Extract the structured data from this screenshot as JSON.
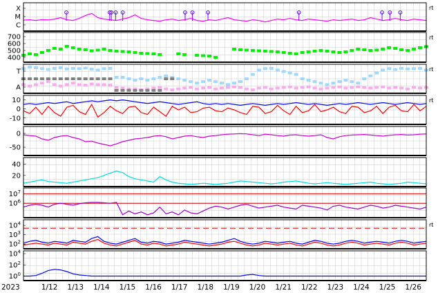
{
  "chart_data": [
    {
      "type": "line",
      "panel": "xray-class",
      "yticks": [
        "X",
        "M",
        "C"
      ],
      "series": [
        {
          "color": "#ff00ff",
          "values": [
            1.55,
            1.6,
            1.5,
            1.62,
            1.58,
            1.7,
            1.9,
            1.6,
            1.5,
            1.8,
            2.2,
            2.5,
            1.9,
            1.7,
            1.6,
            1.5,
            1.7,
            1.9,
            2.3,
            1.8,
            1.6,
            1.5,
            1.4,
            1.6,
            1.7,
            1.5,
            1.6,
            1.8,
            1.5,
            1.4,
            1.6,
            1.5,
            1.7,
            1.9,
            1.6,
            1.5,
            1.4,
            1.6,
            1.5,
            1.3,
            1.5,
            1.7,
            1.6,
            1.8,
            1.6,
            1.5,
            1.7,
            1.6,
            1.5,
            1.4,
            1.6,
            1.5,
            1.6,
            1.7,
            1.5,
            1.6,
            1.9,
            1.7,
            1.5,
            1.6,
            1.8,
            1.6,
            1.5,
            1.7,
            1.6,
            1.5
          ]
        }
      ],
      "event_days": [
        12.65,
        14.32,
        14.38,
        14.55,
        14.82,
        17.22,
        17.5,
        18.1,
        21.6,
        24.8,
        25.1,
        25.5
      ],
      "ylim": [
        0,
        4
      ]
    },
    {
      "type": "scatter",
      "panel": "solar-wind-speed",
      "yticks": [
        400,
        500,
        600,
        700
      ],
      "ylim": [
        330,
        760
      ],
      "series": [
        {
          "color": "#00ee00",
          "values": [
            430,
            450,
            440,
            470,
            500,
            530,
            520,
            560,
            540,
            520,
            510,
            495,
            505,
            520,
            500,
            490,
            485,
            480,
            470,
            460,
            455,
            450,
            440,
            null,
            null,
            450,
            440,
            null,
            430,
            425,
            420,
            400,
            null,
            null,
            520,
            510,
            505,
            500,
            495,
            490,
            485,
            480,
            470,
            460,
            450,
            470,
            480,
            490,
            500,
            490,
            480,
            470,
            480,
            500,
            520,
            510,
            500,
            505,
            520,
            540,
            530,
            510,
            500,
            520,
            540,
            555
          ]
        }
      ]
    },
    {
      "type": "scatter",
      "panel": "imf-sector",
      "yticks": [
        "T",
        "A"
      ],
      "series": [
        {
          "color": "#a0d8ff",
          "values": [
            0.85,
            0.9,
            0.88,
            0.85,
            0.82,
            0.86,
            0.88,
            0.84,
            0.86,
            0.85,
            0.87,
            0.83,
            0.8,
            0.85,
            0.86,
            0.55,
            0.55,
            0.5,
            0.45,
            0.5,
            0.45,
            0.5,
            0.55,
            0.6,
            0.55,
            0.5,
            0.45,
            0.4,
            0.35,
            0.4,
            0.45,
            0.4,
            0.35,
            0.3,
            0.35,
            0.4,
            0.5,
            0.65,
            0.8,
            0.85,
            0.86,
            0.8,
            0.75,
            0.7,
            0.65,
            0.5,
            0.45,
            0.4,
            0.35,
            0.3,
            0.35,
            0.4,
            0.45,
            0.4,
            0.35,
            0.5,
            0.6,
            0.7,
            0.8,
            0.85,
            0.82,
            0.86,
            0.84,
            0.85,
            0.86,
            0.8
          ]
        },
        {
          "color": "#ffaaee",
          "values": [
            0.3,
            0.25,
            0.3,
            0.35,
            0.4,
            0.3,
            0.25,
            0.3,
            0.35,
            0.3,
            0.28,
            0.32,
            0.3,
            0.3,
            0.28,
            0.2,
            0.18,
            0.15,
            0.15,
            0.12,
            0.15,
            0.18,
            0.2,
            0.15,
            0.12,
            0.15,
            0.18,
            0.2,
            0.15,
            0.18,
            0.2,
            0.15,
            0.18,
            0.2,
            0.22,
            0.2,
            0.15,
            0.12,
            0.18,
            0.2,
            0.15,
            0.18,
            0.2,
            0.22,
            0.18,
            0.2,
            0.22,
            0.18,
            0.15,
            0.18,
            0.2,
            0.22,
            0.18,
            0.2,
            0.22,
            0.2,
            0.18,
            0.2,
            0.22,
            0.18,
            0.2,
            0.18,
            0.15,
            0.2,
            0.18,
            0.2
          ]
        },
        {
          "color": "#808080",
          "values": [
            0.5,
            0.5,
            0.5,
            0.5,
            0.5,
            0.5,
            0.5,
            0.5,
            0.5,
            0.5,
            0.5,
            0.5,
            0.5,
            0.5,
            0.5,
            0.1,
            0.1,
            0.1,
            0.1,
            0.1,
            0.1,
            0.1,
            0.1,
            0.5,
            0.5,
            null,
            null,
            null,
            null,
            null,
            null,
            null,
            null,
            null,
            null,
            null,
            null,
            null,
            null,
            null,
            null,
            null,
            null,
            null,
            null,
            null,
            null,
            null,
            null,
            null,
            null,
            null,
            null,
            null,
            null,
            null,
            null,
            null,
            null,
            null,
            null,
            null,
            null,
            null,
            null,
            null
          ]
        }
      ]
    },
    {
      "type": "line",
      "panel": "imf-bz-bt",
      "yticks": [
        10,
        0,
        -10
      ],
      "ylim": [
        -17,
        15
      ],
      "series": [
        {
          "color": "#0000ee",
          "values": [
            5,
            6,
            5,
            6,
            7,
            6,
            7,
            8,
            6,
            7,
            8,
            9,
            8,
            9,
            10,
            9,
            10,
            9,
            8,
            7,
            6,
            7,
            8,
            7,
            6,
            5,
            6,
            7,
            8,
            6,
            5,
            6,
            5,
            6,
            5,
            4,
            5,
            6,
            5,
            4,
            5,
            6,
            5,
            6,
            7,
            6,
            5,
            6,
            5,
            4,
            5,
            6,
            5,
            6,
            7,
            6,
            5,
            6,
            7,
            6,
            5,
            6,
            7,
            6,
            5,
            6
          ]
        },
        {
          "color": "#ff0000",
          "values": [
            -2,
            -5,
            2,
            -6,
            3,
            -4,
            -8,
            2,
            4,
            -3,
            -6,
            5,
            -9,
            -4,
            3,
            -2,
            -5,
            2,
            3,
            -4,
            -6,
            2,
            -3,
            -8,
            3,
            -1,
            2,
            -4,
            -3,
            1,
            2,
            -2,
            -3,
            1,
            -1,
            -4,
            -6,
            3,
            2,
            -5,
            -3,
            4,
            -2,
            -6,
            3,
            -4,
            -2,
            5,
            -3,
            -1,
            2,
            -3,
            -5,
            3,
            2,
            -4,
            -2,
            3,
            -5,
            2,
            4,
            -2,
            -3,
            5,
            -2,
            3
          ]
        }
      ]
    },
    {
      "type": "line",
      "panel": "dst-index",
      "yticks": [
        0,
        -50
      ],
      "ylim": [
        -80,
        25
      ],
      "series": [
        {
          "color": "#cc00cc",
          "values": [
            -5,
            -8,
            -10,
            -20,
            -25,
            -15,
            -10,
            -8,
            -15,
            -20,
            -30,
            -28,
            -35,
            -40,
            -45,
            -38,
            -30,
            -25,
            -20,
            -18,
            -15,
            -10,
            -8,
            -12,
            -20,
            -15,
            -10,
            -8,
            -12,
            -15,
            -10,
            -8,
            -5,
            -3,
            -2,
            -1,
            -2,
            -5,
            -8,
            -3,
            -5,
            -8,
            -10,
            -6,
            -5,
            -8,
            -10,
            -8,
            -5,
            -15,
            -20,
            -12,
            -8,
            -6,
            -5,
            -4,
            -6,
            -8,
            -10,
            -7,
            -5,
            -4,
            -6,
            -5,
            -3,
            -2
          ]
        }
      ]
    },
    {
      "type": "line",
      "panel": "kp-index",
      "yticks": [
        20,
        40
      ],
      "ylim": [
        0,
        52
      ],
      "series": [
        {
          "color": "#00dddd",
          "values": [
            6,
            8,
            10,
            12,
            9,
            8,
            7,
            6,
            8,
            10,
            12,
            14,
            16,
            20,
            24,
            28,
            25,
            18,
            14,
            12,
            10,
            8,
            18,
            12,
            8,
            6,
            5,
            4,
            5,
            6,
            5,
            4,
            5,
            6,
            8,
            10,
            9,
            8,
            7,
            6,
            5,
            6,
            8,
            9,
            10,
            8,
            6,
            5,
            6,
            7,
            6,
            5,
            4,
            5,
            6,
            7,
            8,
            6,
            5,
            4,
            5,
            6,
            8,
            7,
            6,
            5
          ]
        }
      ]
    },
    {
      "type": "line",
      "panel": "electron-flux",
      "yticks": [
        "10^6",
        "10^7"
      ],
      "ylim": [
        4.5,
        7.6
      ],
      "threshold_value": 6.0,
      "threshold_value_2": 7.0,
      "series": [
        {
          "color": "#9900cc",
          "values": [
            5.6,
            5.8,
            5.9,
            5.8,
            5.6,
            5.9,
            6.0,
            5.9,
            5.8,
            5.95,
            6.05,
            6.1,
            6.1,
            6.05,
            6.0,
            6.1,
            4.8,
            5.2,
            4.9,
            5.1,
            4.8,
            5.0,
            5.6,
            4.9,
            5.1,
            4.8,
            5.3,
            5.0,
            4.9,
            5.2,
            5.5,
            5.7,
            5.6,
            5.4,
            5.6,
            5.8,
            5.9,
            5.7,
            5.5,
            5.6,
            5.7,
            5.8,
            5.6,
            5.5,
            5.4,
            5.8,
            5.7,
            5.6,
            5.5,
            5.3,
            5.7,
            5.8,
            5.6,
            5.5,
            5.4,
            5.6,
            5.8,
            5.7,
            5.5,
            5.6,
            5.8,
            5.7,
            5.6,
            5.5,
            5.4,
            5.6
          ]
        }
      ]
    },
    {
      "type": "line",
      "panel": "proton-flux",
      "yticks": [
        "10^2",
        "10^3",
        "10^4"
      ],
      "ylim": [
        1.5,
        4.6
      ],
      "threshold_value": 3.7,
      "series": [
        {
          "color": "#0000ee",
          "values": [
            2.1,
            2.3,
            2.4,
            2.2,
            2.1,
            2.3,
            2.2,
            2.1,
            2.4,
            2.3,
            2.2,
            2.6,
            2.8,
            2.3,
            2.1,
            2.0,
            2.2,
            2.4,
            2.6,
            2.2,
            2.1,
            2.3,
            2.2,
            2.0,
            2.1,
            2.2,
            2.4,
            2.3,
            2.2,
            2.1,
            2.0,
            2.1,
            2.2,
            2.4,
            2.6,
            2.3,
            2.1,
            2.0,
            2.1,
            2.3,
            2.2,
            2.1,
            2.2,
            2.3,
            2.1,
            2.0,
            2.2,
            2.4,
            2.3,
            2.1,
            2.0,
            2.1,
            2.3,
            2.4,
            2.3,
            2.1,
            2.2,
            2.3,
            2.2,
            2.1,
            2.3,
            2.4,
            2.3,
            2.1,
            2.2,
            2.3
          ]
        },
        {
          "color": "#ff0000",
          "values": [
            1.9,
            2.0,
            2.1,
            2.0,
            1.9,
            2.1,
            2.0,
            1.9,
            2.2,
            2.1,
            2.0,
            2.3,
            2.5,
            2.1,
            1.9,
            1.8,
            2.0,
            2.2,
            2.4,
            2.0,
            1.9,
            2.1,
            2.0,
            1.8,
            1.9,
            2.0,
            2.2,
            2.1,
            2.0,
            1.9,
            1.8,
            1.9,
            2.0,
            2.2,
            2.3,
            2.1,
            1.9,
            1.8,
            1.9,
            2.1,
            2.0,
            1.9,
            2.0,
            2.1,
            1.9,
            1.8,
            2.0,
            2.2,
            2.1,
            1.9,
            1.8,
            1.9,
            2.1,
            2.2,
            2.1,
            1.9,
            2.0,
            2.1,
            2.0,
            1.9,
            2.1,
            2.2,
            2.1,
            1.9,
            2.0,
            2.1
          ]
        }
      ]
    },
    {
      "type": "line",
      "panel": "high-energy-proton",
      "yticks": [
        "10^0",
        "10^2",
        "10^4"
      ],
      "ylim": [
        -0.8,
        4.5
      ],
      "series": [
        {
          "color": "#0000ee",
          "values": [
            0,
            0,
            0.1,
            0.5,
            1.0,
            1.2,
            1.1,
            0.8,
            0.4,
            0.2,
            0.1,
            0,
            0,
            0,
            0,
            0,
            0,
            0,
            0,
            0,
            0,
            0,
            0,
            0,
            0,
            0,
            0,
            0,
            0,
            0,
            0,
            0,
            0,
            0,
            0,
            0,
            0.2,
            0.3,
            0.1,
            0,
            0,
            0,
            0,
            0,
            0,
            0,
            0,
            0,
            0,
            0,
            0,
            0,
            0,
            0,
            0,
            0,
            0,
            0,
            0,
            0,
            0,
            0,
            0,
            0,
            0,
            0
          ]
        }
      ]
    }
  ],
  "x_axis": {
    "start": 11.0,
    "end": 26.5,
    "tick_labels": [
      "2023",
      "1/12",
      "1/13",
      "1/14",
      "1/15",
      "1/16",
      "1/17",
      "1/18",
      "1/19",
      "1/20",
      "1/21",
      "1/22",
      "1/23",
      "1/24",
      "1/25",
      "1/26"
    ],
    "tick_days": [
      11,
      12,
      13,
      14,
      15,
      16,
      17,
      18,
      19,
      20,
      21,
      22,
      23,
      24,
      25,
      26
    ]
  },
  "side_marker": "rt",
  "colors": {
    "grid": "#c8c8c8",
    "frame": "#000000",
    "threshold": "#dd0000"
  }
}
